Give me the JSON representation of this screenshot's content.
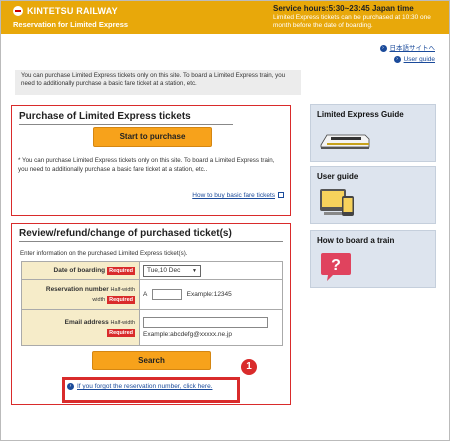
{
  "header": {
    "logo_name": "KINTETSU RAILWAY",
    "logo_sub": "Reservation for Limited Express",
    "service_title": "Service hours:5:30~23:45 Japan time",
    "service_note": "Limited Express tickets can be purchased at 10:30 one month before the date of boarding."
  },
  "links": {
    "japanese": "日本語サイトへ",
    "user_guide": "User guide"
  },
  "notice": "You can purchase Limited Express tickets only on this site. To board a Limited Express train, you need to additionally purchase a basic fare ticket at a station, etc.",
  "purchase": {
    "title": "Purchase of Limited Express tickets",
    "button": "Start to purchase",
    "note": "* You can purchase Limited Express tickets only on this site. To board a Limited Express train, you need to additionally purchase a basic fare ticket at a station, etc..",
    "fare_link": "How to buy basic fare tickets"
  },
  "review": {
    "title": "Review/refund/change of purchased ticket(s)",
    "intro": "Enter information on the purchased Limited Express ticket(s).",
    "required": "Required",
    "half_width": "Half-width",
    "date_label": "Date of boarding",
    "date_value": "Tue,10 Dec",
    "resv_label": "Reservation number",
    "resv_prefix": "A",
    "resv_example": "Example:12345",
    "email_label": "Email address",
    "email_example": "Example:abcdefg@xxxxx.ne.jp",
    "search_button": "Search",
    "forgot_link": "If you forgot the reservation number, click here."
  },
  "annotation": {
    "marker": "1"
  },
  "side": {
    "guide_title": "Limited Express Guide",
    "user_title": "User guide",
    "board_title": "How to board a train"
  },
  "colors": {
    "brand": "#e8a80a",
    "accent": "#d92b2b",
    "button": "#f7a21b"
  }
}
